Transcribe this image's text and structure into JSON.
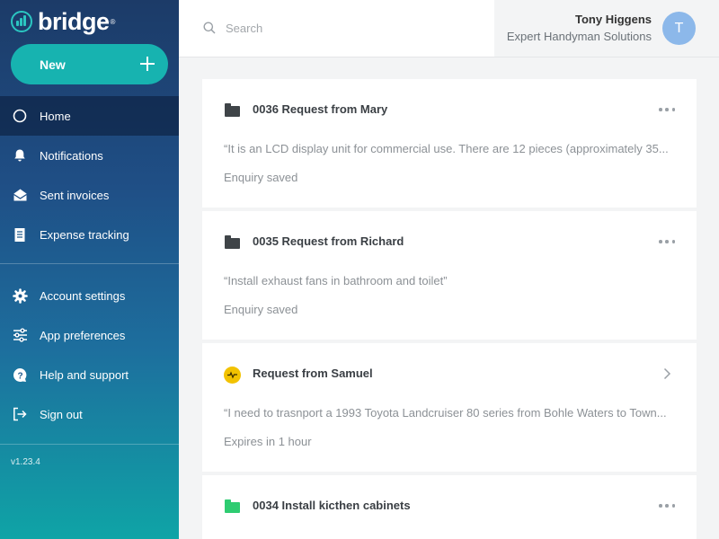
{
  "app": {
    "brand": "bridge",
    "brand_mark": "®",
    "version": "v1.23.4",
    "accent_color": "#17b3b0"
  },
  "sidebar": {
    "new_button": {
      "label": "New",
      "icon": "plus-icon"
    },
    "items": [
      {
        "label": "Home",
        "icon": "home-circle-icon",
        "active": true
      },
      {
        "label": "Notifications",
        "icon": "bell-icon"
      },
      {
        "label": "Sent invoices",
        "icon": "envelope-icon"
      },
      {
        "label": "Expense tracking",
        "icon": "receipt-icon"
      }
    ],
    "secondary_items": [
      {
        "label": "Account settings",
        "icon": "gear-icon"
      },
      {
        "label": "App preferences",
        "icon": "sliders-icon"
      },
      {
        "label": "Help and support",
        "icon": "help-icon"
      },
      {
        "label": "Sign out",
        "icon": "sign-out-icon"
      }
    ]
  },
  "header": {
    "search": {
      "placeholder": "Search",
      "value": ""
    },
    "user": {
      "name": "Tony Higgens",
      "company": "Expert Handyman Solutions",
      "avatar_initial": "T",
      "avatar_color": "#8cb8ea"
    }
  },
  "requests": [
    {
      "title": "0036 Request from Mary",
      "text": "“It is an LCD display unit for commercial use. There are 12 pieces (approximately 35...",
      "status": "Enquiry saved",
      "icon": "folder-icon",
      "icon_color": "#3f4448",
      "action": "more-icon"
    },
    {
      "title": "0035 Request from Richard",
      "text": "“Install exhaust fans in bathroom and toilet”",
      "status": "Enquiry saved",
      "icon": "folder-icon",
      "icon_color": "#3f4448",
      "action": "more-icon"
    },
    {
      "title": "Request from Samuel",
      "text": "“I need to trasnport a 1993 Toyota Landcruiser 80 series from Bohle Waters to Town...",
      "status": "Expires in 1 hour",
      "icon": "requester-logo-icon",
      "icon_color": "#f2c200",
      "action": "chevron-right-icon"
    },
    {
      "title": "0034 Install kicthen cabinets",
      "text": "",
      "status": "",
      "icon": "folder-icon",
      "icon_color": "#2ecc71",
      "action": "more-icon"
    }
  ]
}
